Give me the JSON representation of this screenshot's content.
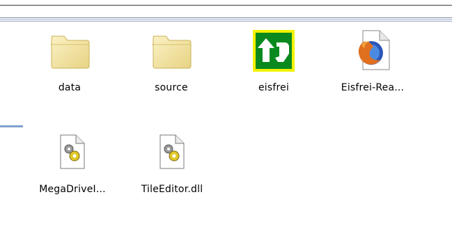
{
  "files": [
    {
      "name": "data",
      "icon": "folder-icon"
    },
    {
      "name": "source",
      "icon": "folder-icon"
    },
    {
      "name": "eisfrei",
      "icon": "exit-arrow-icon"
    },
    {
      "name": "Eisfrei-Rea...",
      "icon": "firefox-document-icon"
    },
    {
      "name": "MegaDriveI...",
      "icon": "dll-gear-icon"
    },
    {
      "name": "TileEditor.dll",
      "icon": "dll-gear-icon"
    }
  ],
  "colors": {
    "folder": "#f3e6a4",
    "eisfrei_bg": "#0a8a1e",
    "eisfrei_border": "#f2f200",
    "accent": "#7fa0cd"
  }
}
